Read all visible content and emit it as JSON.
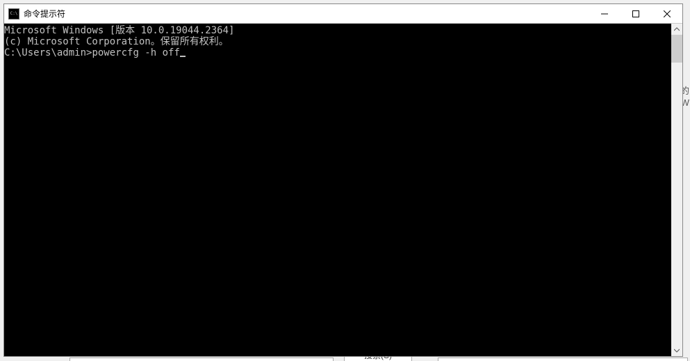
{
  "window": {
    "title": "命令提示符"
  },
  "terminal": {
    "line1": "Microsoft Windows [版本 10.0.19044.2364]",
    "line2": "(c) Microsoft Corporation。保留所有权利。",
    "blank": "",
    "prompt": "C:\\Users\\admin>",
    "command": "powercfg -h off"
  },
  "background": {
    "partial_right_1": "的",
    "partial_right_2": "W",
    "partial_bottom": "搜索(S)"
  }
}
